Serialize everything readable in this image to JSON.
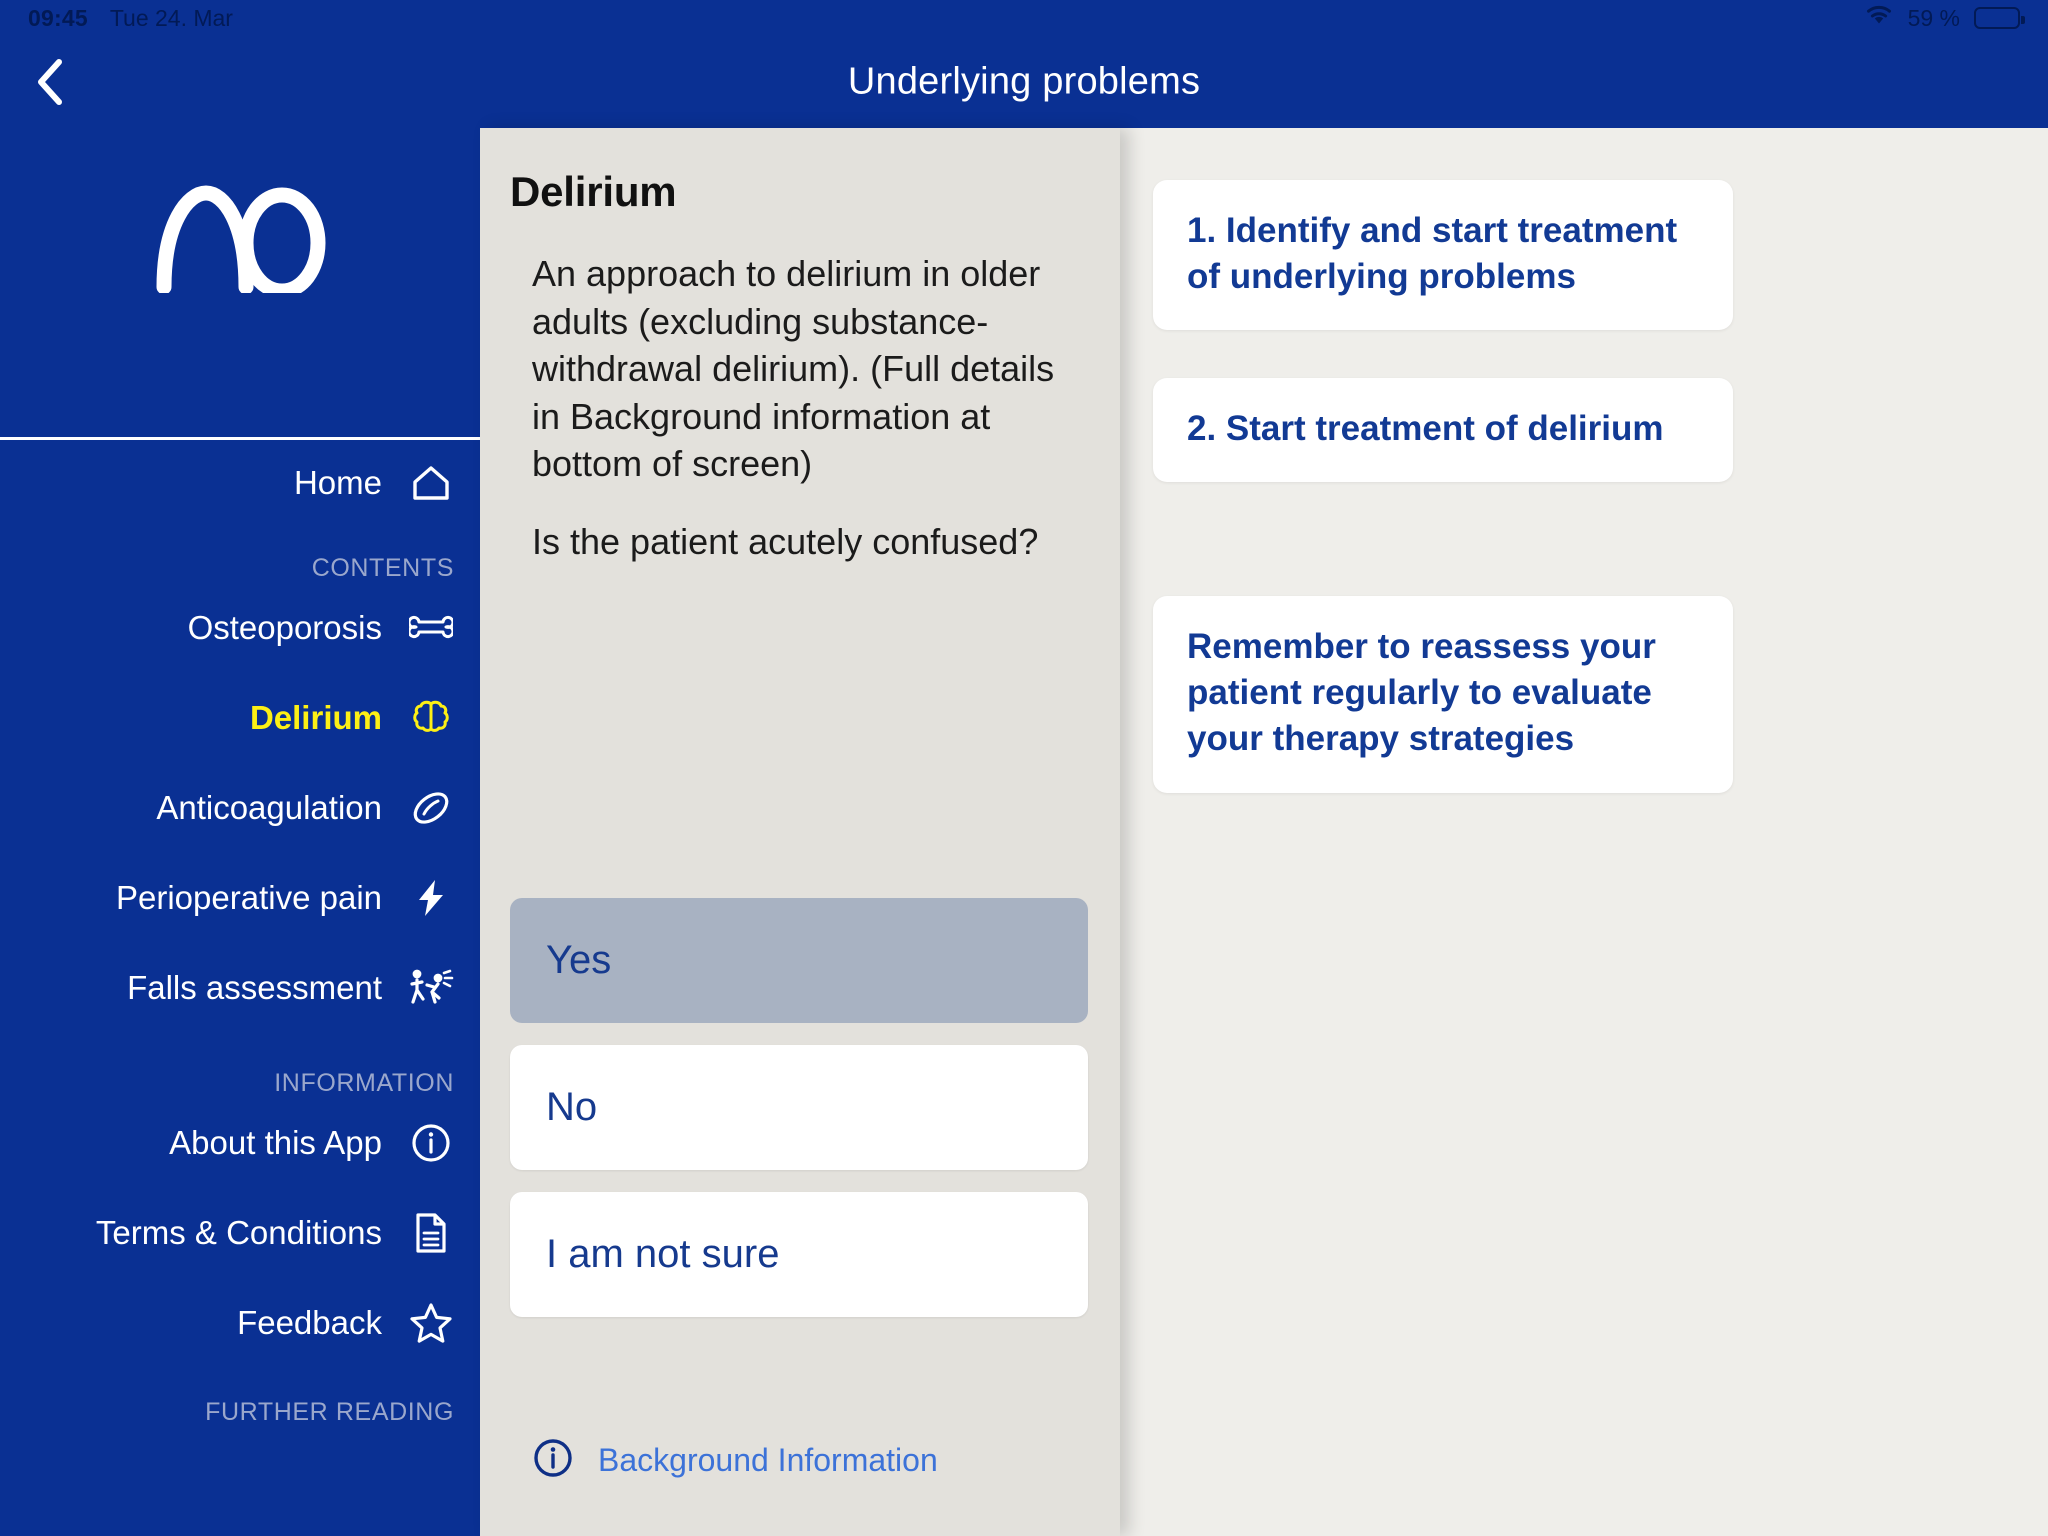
{
  "status_bar": {
    "time": "09:45",
    "date": "Tue 24. Mar",
    "battery_percent": "59 %",
    "wifi_icon": "wifi-icon",
    "battery_icon": "battery-icon",
    "battery_level": 62
  },
  "nav": {
    "back_icon": "chevron-left-icon",
    "title": "Underlying problems"
  },
  "sidebar": {
    "logo": "ao-logo",
    "home": {
      "label": "Home",
      "icon": "home-icon"
    },
    "contents_header": "CONTENTS",
    "contents": [
      {
        "label": "Osteoporosis",
        "icon": "bone-icon",
        "active": false
      },
      {
        "label": "Delirium",
        "icon": "brain-icon",
        "active": true
      },
      {
        "label": "Anticoagulation",
        "icon": "pill-icon",
        "active": false
      },
      {
        "label": "Perioperative pain",
        "icon": "lightning-bolt-icon",
        "active": false
      },
      {
        "label": "Falls assessment",
        "icon": "falling-person-icon",
        "active": false
      }
    ],
    "information_header": "INFORMATION",
    "information": [
      {
        "label": "About this App",
        "icon": "info-circle-icon"
      },
      {
        "label": "Terms & Conditions",
        "icon": "document-icon"
      },
      {
        "label": "Feedback",
        "icon": "star-icon"
      }
    ],
    "further_reading_header": "FURTHER READING"
  },
  "main": {
    "title": "Delirium",
    "paragraphs": [
      "An approach to delirium in older adults (excluding substance-withdrawal delirium). (Full details in Background information at bottom of screen)",
      "Is the patient acutely confused?"
    ],
    "options": [
      {
        "label": "Yes",
        "selected": true
      },
      {
        "label": "No",
        "selected": false
      },
      {
        "label": "I am not sure",
        "selected": false
      }
    ],
    "background_link": {
      "label": "Background Information",
      "icon": "info-circle-icon"
    }
  },
  "right_panel": {
    "cards": [
      {
        "text": "1. Identify and start treatment of underlying problems"
      },
      {
        "text": "2. Start treatment of delirium"
      },
      {
        "text": "Remember to reassess your patient regularly to evaluate your therapy strategies"
      }
    ]
  },
  "colors": {
    "brand_blue": "#0a3093",
    "accent_yellow": "#fdf015",
    "card_text_blue": "#123a94",
    "link_blue": "#3c72d8",
    "selected_option": "#a8b2c2",
    "mid_bg": "#e3e1dc",
    "right_bg": "#efeeea"
  }
}
